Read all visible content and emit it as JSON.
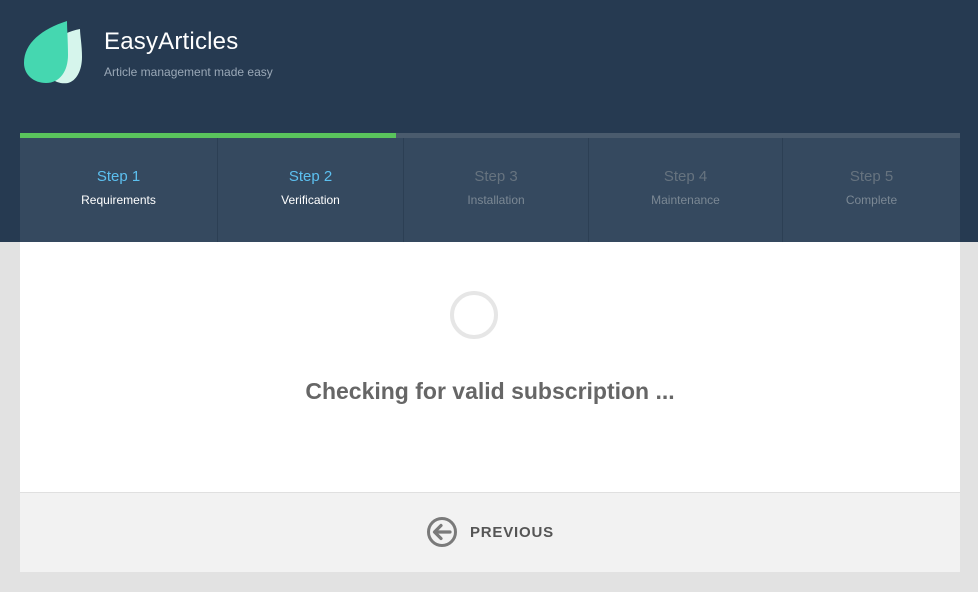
{
  "brand": {
    "title": "EasyArticles",
    "subtitle": "Article management made easy",
    "logo_icon": "leaf-logo-icon"
  },
  "colors": {
    "header_bg": "#263a51",
    "steps_bg": "#35495f",
    "progress": "#5ac45c",
    "active_step": "#5cc0f0"
  },
  "progress": {
    "completed_fraction": 0.4
  },
  "steps": [
    {
      "number": "Step 1",
      "label": "Requirements",
      "state": "done"
    },
    {
      "number": "Step 2",
      "label": "Verification",
      "state": "active"
    },
    {
      "number": "Step 3",
      "label": "Installation",
      "state": "pending"
    },
    {
      "number": "Step 4",
      "label": "Maintenance",
      "state": "pending"
    },
    {
      "number": "Step 5",
      "label": "Complete",
      "state": "pending"
    }
  ],
  "main": {
    "status_text": "Checking for valid subscription ..."
  },
  "footer": {
    "previous_label": "PREVIOUS",
    "previous_icon": "arrow-left-circle-icon"
  }
}
